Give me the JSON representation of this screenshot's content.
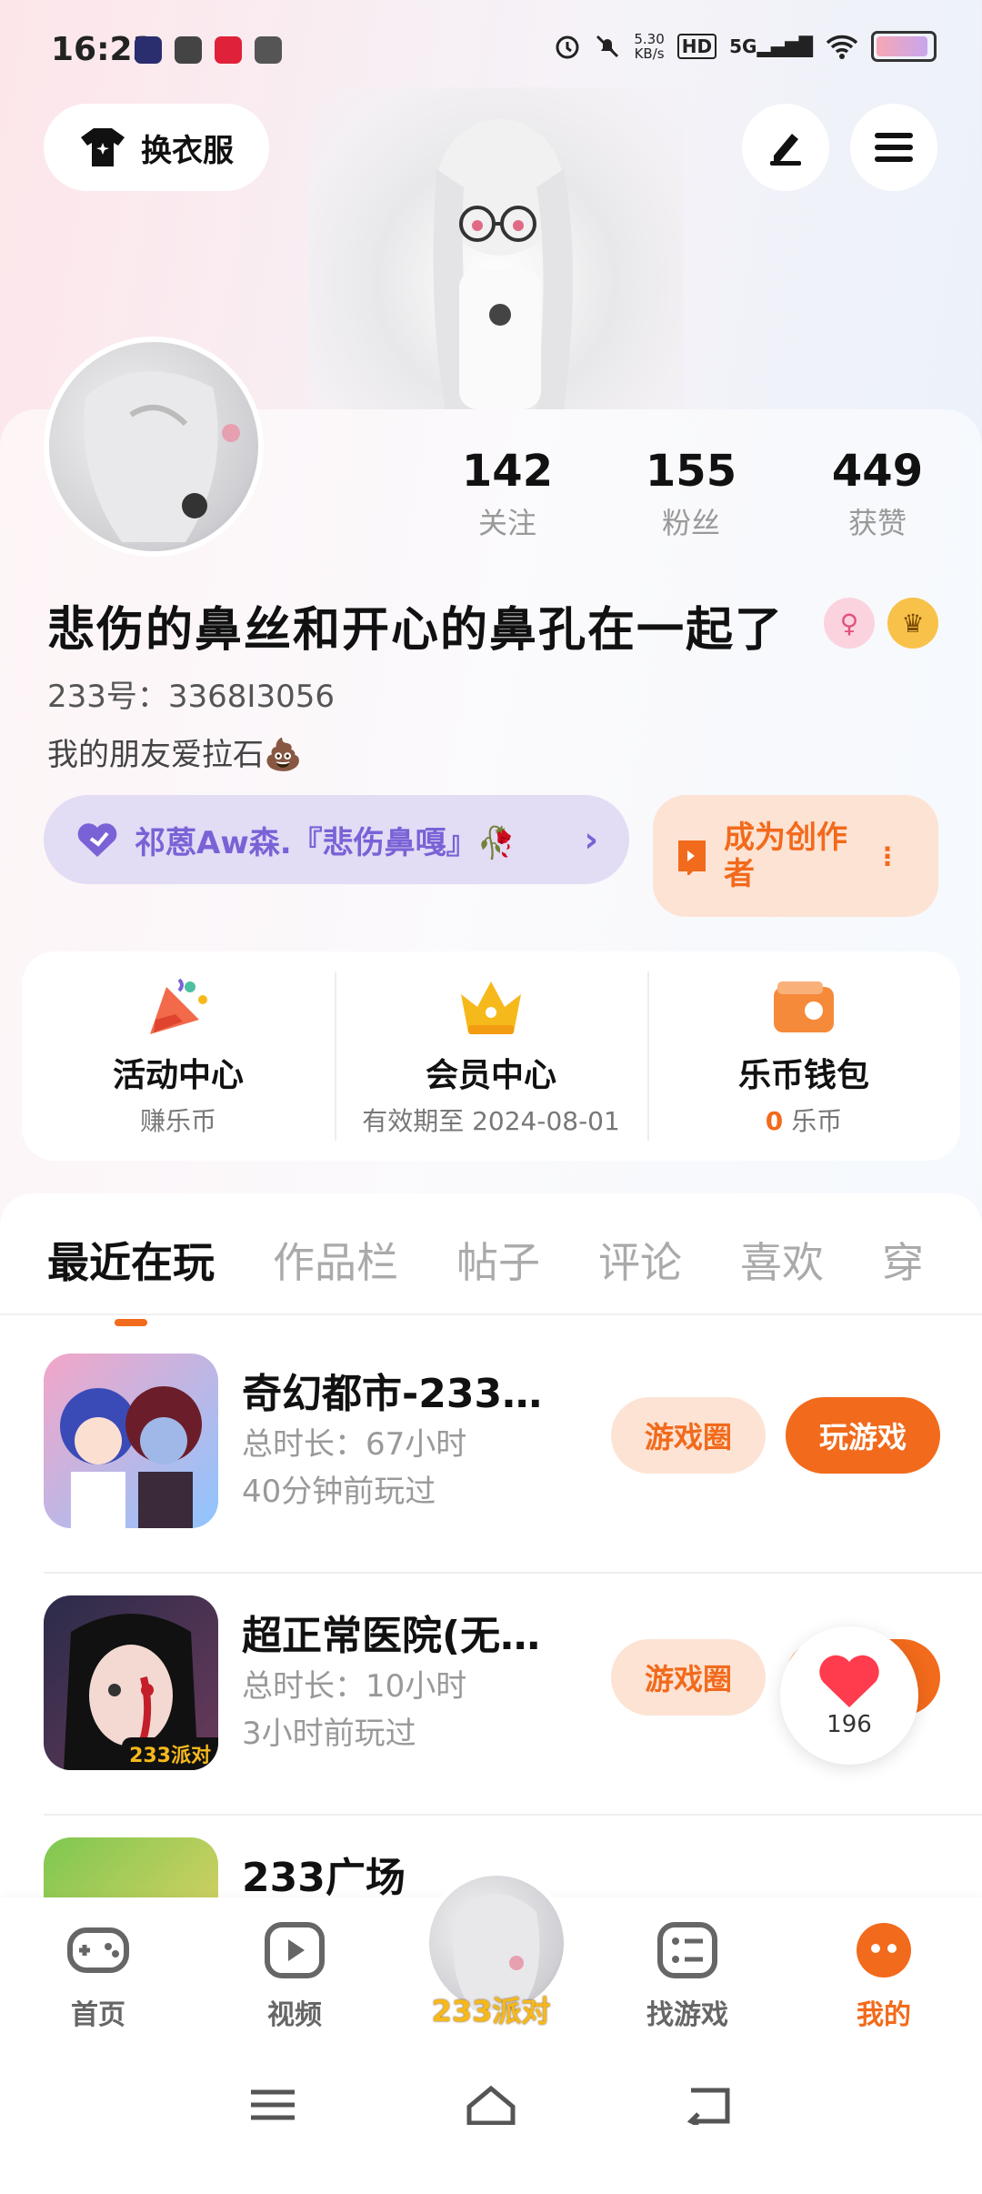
{
  "status_bar": {
    "time": "16:23",
    "net_speed_value": "5.30",
    "net_speed_unit": "KB/s",
    "hd_label": "HD",
    "signal_label": "5G",
    "app_icons": [
      "video-app-icon",
      "link-app-icon",
      "shop-app-icon",
      "player-app-icon"
    ]
  },
  "header": {
    "outfit_label": "换衣服"
  },
  "profile": {
    "stats": [
      {
        "value": "142",
        "label": "关注"
      },
      {
        "value": "155",
        "label": "粉丝"
      },
      {
        "value": "449",
        "label": "获赞"
      }
    ],
    "nickname": "悲伤的鼻丝和开心的鼻孔在一起了",
    "uid": "233号：3368I3056",
    "bio": "我的朋友爱拉石💩",
    "family_name": "祁蒽Aw森.『悲伤鼻嘎』🥀",
    "creator_label": "成为创作者"
  },
  "quick_menu": [
    {
      "title": "活动中心",
      "sub": "赚乐币"
    },
    {
      "title": "会员中心",
      "sub": "有效期至 2024-08-01"
    },
    {
      "title": "乐币钱包",
      "sub_value": "0",
      "sub_unit": "乐币"
    }
  ],
  "tabs": [
    "最近在玩",
    "作品栏",
    "帖子",
    "评论",
    "喜欢",
    "穿"
  ],
  "games": [
    {
      "title": "奇幻都市-233…",
      "duration": "总时长：67小时",
      "last_played": "40分钟前玩过",
      "circle_label": "游戏圈",
      "play_label": "玩游戏"
    },
    {
      "title": "超正常医院(无…",
      "duration": "总时长：10小时",
      "last_played": "3小时前玩过",
      "circle_label": "游戏圈",
      "play_label": "玩游戏",
      "icon_badge": "233派对"
    },
    {
      "title": "233广场"
    }
  ],
  "like_float": {
    "count": "196"
  },
  "bottom_nav": {
    "items": [
      "首页",
      "视频",
      "233派对",
      "找游戏",
      "我的"
    ],
    "active": "我的"
  },
  "colors": {
    "accent": "#f26a1b",
    "accent_soft": "#fde3d4",
    "family_purple": "#7a62d6",
    "family_bg": "#e2dcf5"
  }
}
